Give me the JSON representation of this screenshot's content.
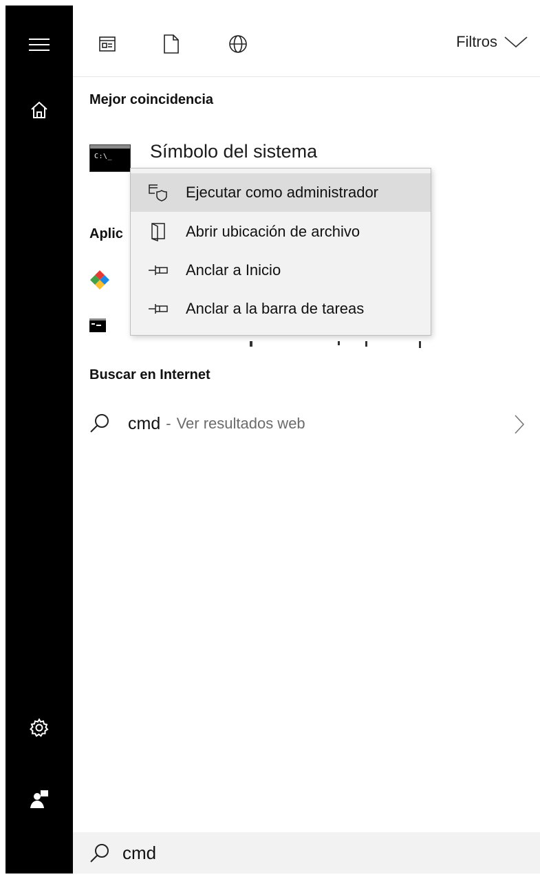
{
  "search": {
    "query": "cmd"
  },
  "toolbar": {
    "filters_label": "Filtros"
  },
  "sections": {
    "best_match": "Mejor coincidencia",
    "apps_partial": "Aplic",
    "web": "Buscar en Internet"
  },
  "best_match_item": {
    "title": "Símbolo del sistema",
    "icon_text": "C:\\_"
  },
  "context_menu": {
    "items": [
      {
        "label": "Ejecutar como administrador",
        "icon": "run-as-admin-icon"
      },
      {
        "label": "Abrir ubicación de archivo",
        "icon": "open-file-location-icon"
      },
      {
        "label": "Anclar a Inicio",
        "icon": "pin-icon"
      },
      {
        "label": "Anclar a la barra de tareas",
        "icon": "pin-icon"
      }
    ]
  },
  "web_result": {
    "query": "cmd",
    "separator": "-",
    "suffix": "Ver resultados web"
  },
  "colors": {
    "sidebar": "#000000",
    "menu_bg": "#f2f2f2",
    "menu_highlight": "#dcdcdc",
    "search_bg": "#f2f2f2"
  }
}
